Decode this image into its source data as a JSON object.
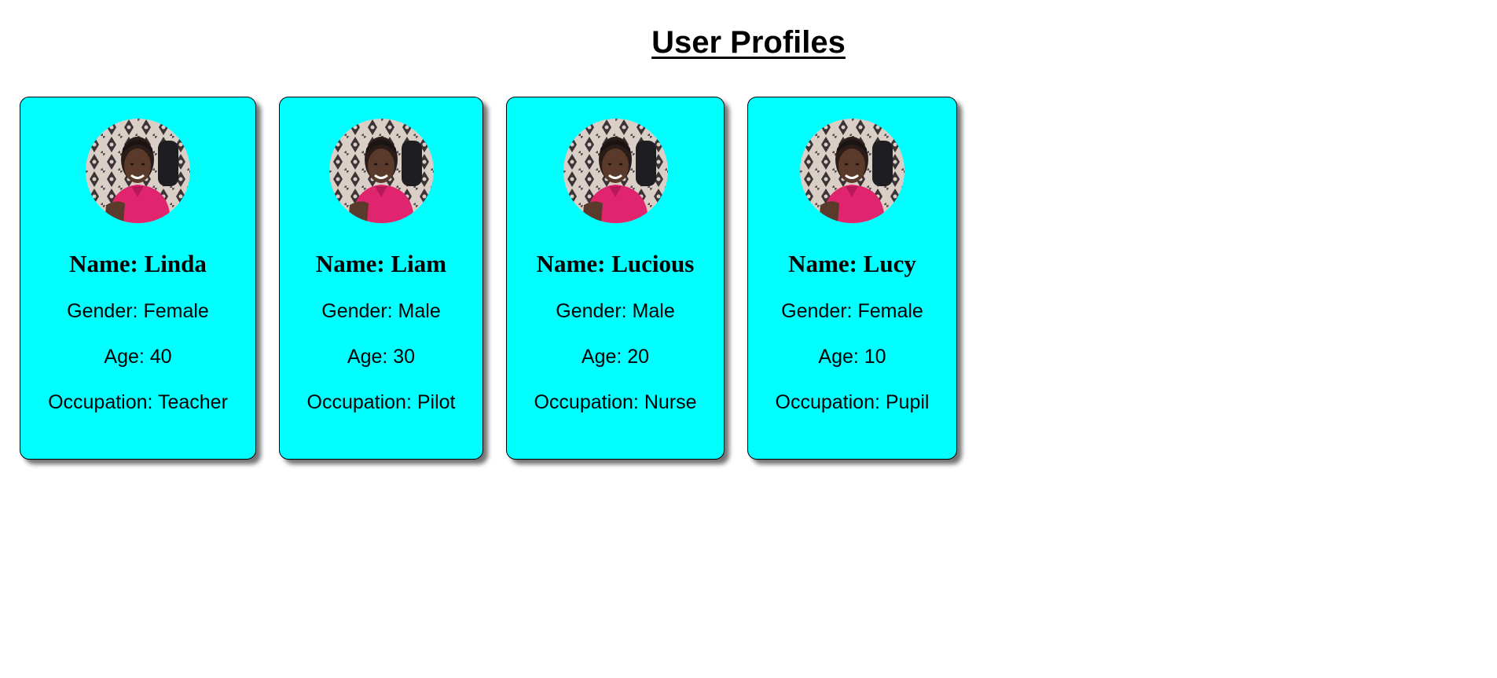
{
  "page": {
    "title": "User Profiles"
  },
  "colors": {
    "card_background": "#00ffff",
    "card_border": "#000000",
    "shirt": "#e0246e"
  },
  "profiles": [
    {
      "avatar_icon": "profile-photo",
      "name": "Name: Linda",
      "gender": "Gender: Female",
      "age": "Age: 40",
      "occupation": "Occupation: Teacher"
    },
    {
      "avatar_icon": "profile-photo",
      "name": "Name: Liam",
      "gender": "Gender: Male",
      "age": "Age: 30",
      "occupation": "Occupation: Pilot"
    },
    {
      "avatar_icon": "profile-photo",
      "name": "Name: Lucious",
      "gender": "Gender: Male",
      "age": "Age: 20",
      "occupation": "Occupation: Nurse"
    },
    {
      "avatar_icon": "profile-photo",
      "name": "Name: Lucy",
      "gender": "Gender: Female",
      "age": "Age: 10",
      "occupation": "Occupation: Pupil"
    }
  ]
}
